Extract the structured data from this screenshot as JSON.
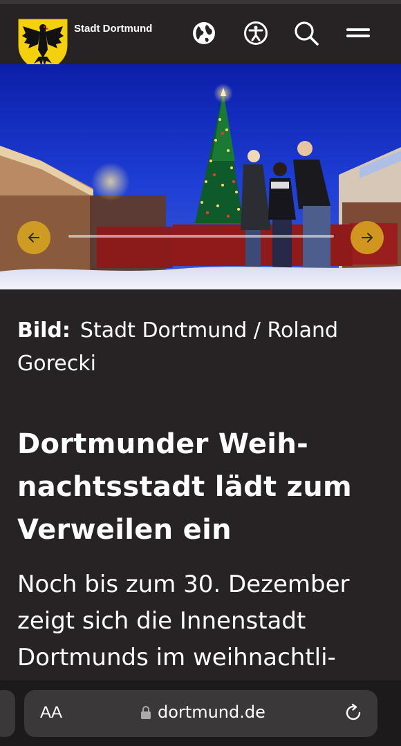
{
  "header": {
    "brand": "Stadt Dortmund",
    "icons": [
      "globe-icon",
      "accessibility-icon",
      "search-icon",
      "menu-icon"
    ]
  },
  "hero": {
    "description_icons": [
      "arrow-left-icon",
      "arrow-right-icon"
    ]
  },
  "credit": {
    "label": "Bild:",
    "text": "Stadt Dortmund / Roland Gorecki"
  },
  "article": {
    "headline": "Dortmunder Weih­nachtsstadt lädt zum Verweilen ein",
    "lead": "Noch bis zum 30. Dezember zeigt sich die Innenstadt Dortmunds im weihnachtli-"
  },
  "browser": {
    "text_size": "AA",
    "url": "dortmund.de"
  },
  "colors": {
    "background": "#272324",
    "accent": "#d6a321",
    "browser_bar": "#1c1a1b",
    "pill": "#3b3839"
  }
}
